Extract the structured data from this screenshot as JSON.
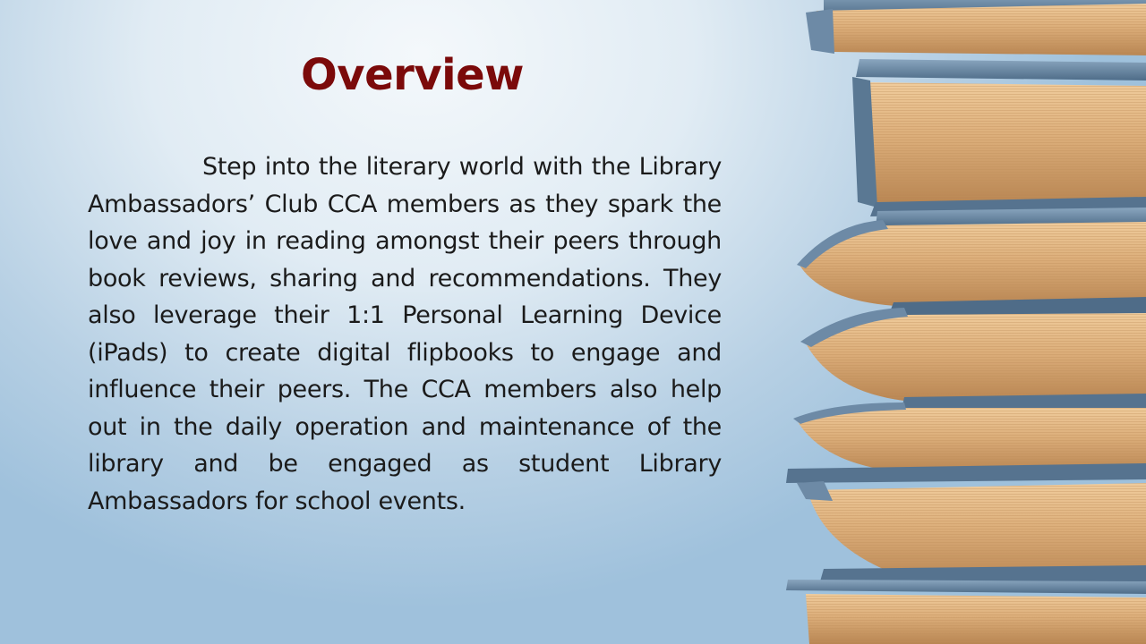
{
  "slide": {
    "title": "Overview",
    "body": "Step into the literary world with the Library Ambassadors’ Club CCA members as they spark the love and joy in reading amongst their peers through book reviews, sharing and recommendations. They also leverage their 1:1 Personal Learning Device (iPads) to create digital flipbooks to engage and influence their peers. The CCA members also help out in the daily operation and maintenance of the library and be engaged as student Library Ambassadors for school events."
  },
  "colors": {
    "title": "#7b0a0a",
    "body_text": "#1b1b1b",
    "book_cover": "#5f7f9c",
    "page_edge": "#dcae7a"
  },
  "image": {
    "subject": "stack-of-books"
  }
}
